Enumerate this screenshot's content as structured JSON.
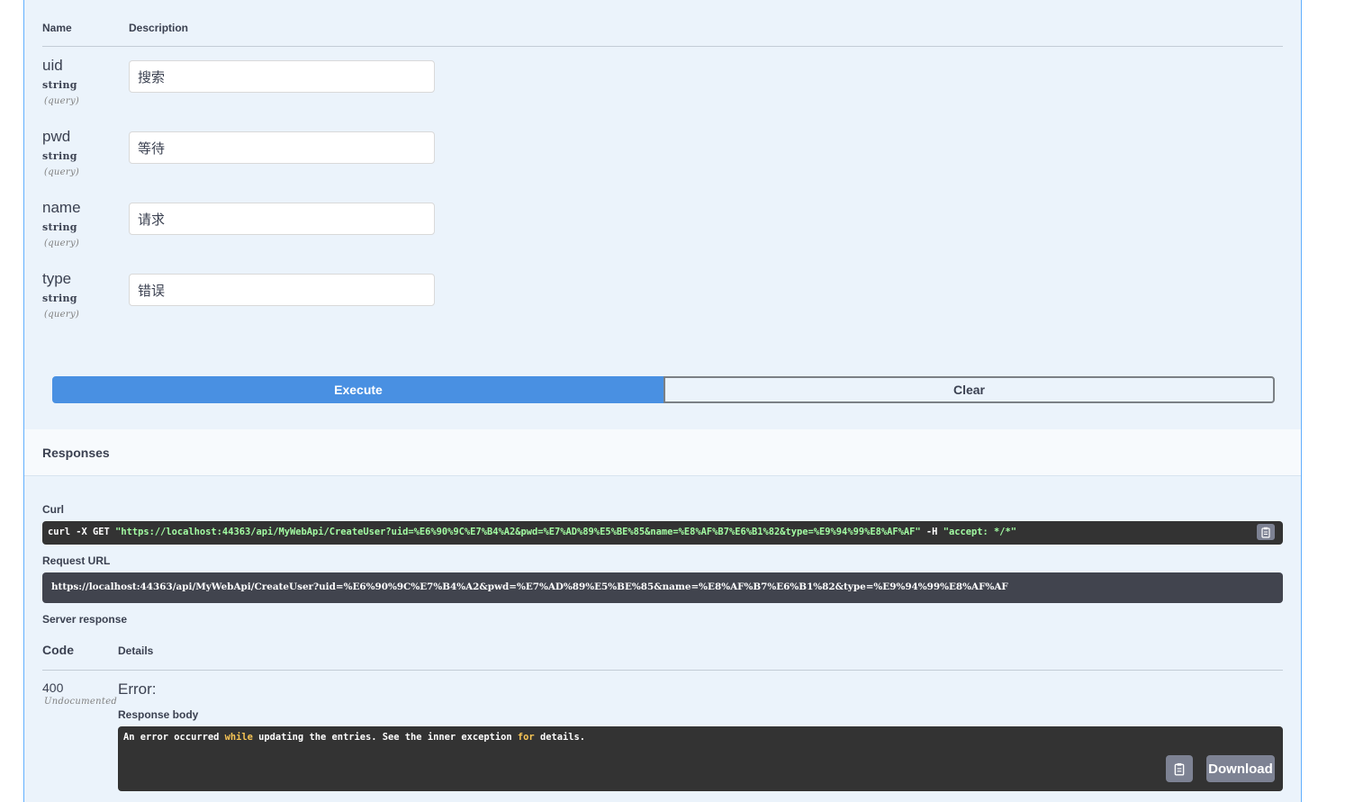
{
  "parameters": {
    "headers": {
      "name": "Name",
      "description": "Description"
    },
    "items": [
      {
        "name": "uid",
        "type": "string",
        "in": "(query)",
        "value": "搜索"
      },
      {
        "name": "pwd",
        "type": "string",
        "in": "(query)",
        "value": "等待"
      },
      {
        "name": "name",
        "type": "string",
        "in": "(query)",
        "value": "请求"
      },
      {
        "name": "type",
        "type": "string",
        "in": "(query)",
        "value": "错误"
      }
    ]
  },
  "actions": {
    "execute": "Execute",
    "clear": "Clear"
  },
  "responses": {
    "title": "Responses",
    "curl_label": "Curl",
    "curl_cmd": "curl -X GET ",
    "curl_url": "\"https://localhost:44363/api/MyWebApi/CreateUser?uid=%E6%90%9C%E7%B4%A2&pwd=%E7%AD%89%E5%BE%85&name=%E8%AF%B7%E6%B1%82&type=%E9%94%99%E8%AF%AF\"",
    "curl_flag": " -H ",
    "curl_header": " \"accept: */*\"",
    "request_url_label": "Request URL",
    "request_url": "https://localhost:44363/api/MyWebApi/CreateUser?uid=%E6%90%9C%E7%B4%A2&pwd=%E7%AD%89%E5%BE%85&name=%E8%AF%B7%E6%B1%82&type=%E9%94%99%E8%AF%AF",
    "server_response_label": "Server response",
    "code_header": "Code",
    "details_header": "Details",
    "code": "400",
    "code_note": "Undocumented",
    "error_label": "Error:",
    "response_body_label": "Response body",
    "body": {
      "p1": "An error occurred ",
      "k1": "while",
      "p2": " updating the entries. See the inner exception ",
      "k2": "for",
      "p3": " details."
    },
    "download_label": "Download"
  },
  "colors": {
    "panel_bg": "#ebf3fb",
    "panel_border": "#61affe",
    "execute": "#4990e2",
    "code_bg": "#333333",
    "url_bg": "#41444e",
    "keyword": "#f8c555",
    "string": "#a2fca2"
  },
  "icons": {
    "copy": "clipboard-icon"
  }
}
